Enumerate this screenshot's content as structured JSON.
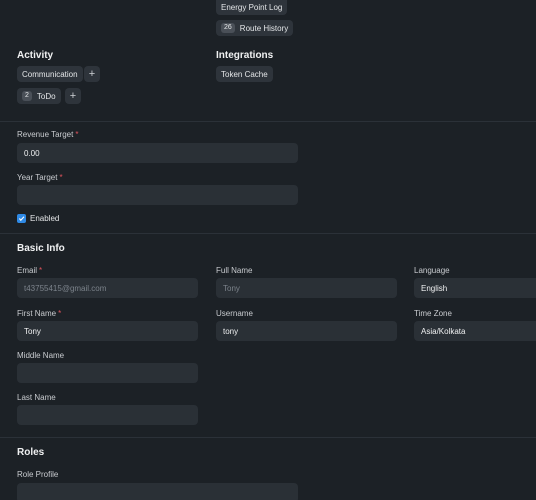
{
  "connections": {
    "top_links": [
      {
        "label": "Energy Point Log",
        "count": ""
      },
      {
        "label": "Route History",
        "count": "26"
      }
    ],
    "activity": {
      "title": "Activity",
      "items": [
        {
          "label": "Communication",
          "count": ""
        },
        {
          "label": "ToDo",
          "count": "2"
        }
      ]
    },
    "integrations": {
      "title": "Integrations",
      "items": [
        {
          "label": "Token Cache",
          "count": ""
        }
      ]
    }
  },
  "targets": {
    "revenue_target": {
      "label": "Revenue Target",
      "value": "0.00"
    },
    "year_target": {
      "label": "Year Target",
      "value": ""
    },
    "enabled": {
      "label": "Enabled",
      "checked": true
    }
  },
  "basic_info": {
    "title": "Basic Info",
    "email": {
      "label": "Email",
      "value": "t43755415@gmail.com"
    },
    "full_name": {
      "label": "Full Name",
      "value": "Tony"
    },
    "language": {
      "label": "Language",
      "value": "English"
    },
    "first_name": {
      "label": "First Name",
      "value": "Tony"
    },
    "username": {
      "label": "Username",
      "value": "tony"
    },
    "time_zone": {
      "label": "Time Zone",
      "value": "Asia/Kolkata"
    },
    "middle_name": {
      "label": "Middle Name",
      "value": ""
    },
    "last_name": {
      "label": "Last Name",
      "value": ""
    }
  },
  "roles": {
    "title": "Roles",
    "role_profile": {
      "label": "Role Profile",
      "value": ""
    }
  },
  "colors": {
    "background": "#1c2126",
    "input": "#2a3036",
    "chip": "#2e343b",
    "required": "#e0535c",
    "checkbox": "#2f8ae6"
  }
}
